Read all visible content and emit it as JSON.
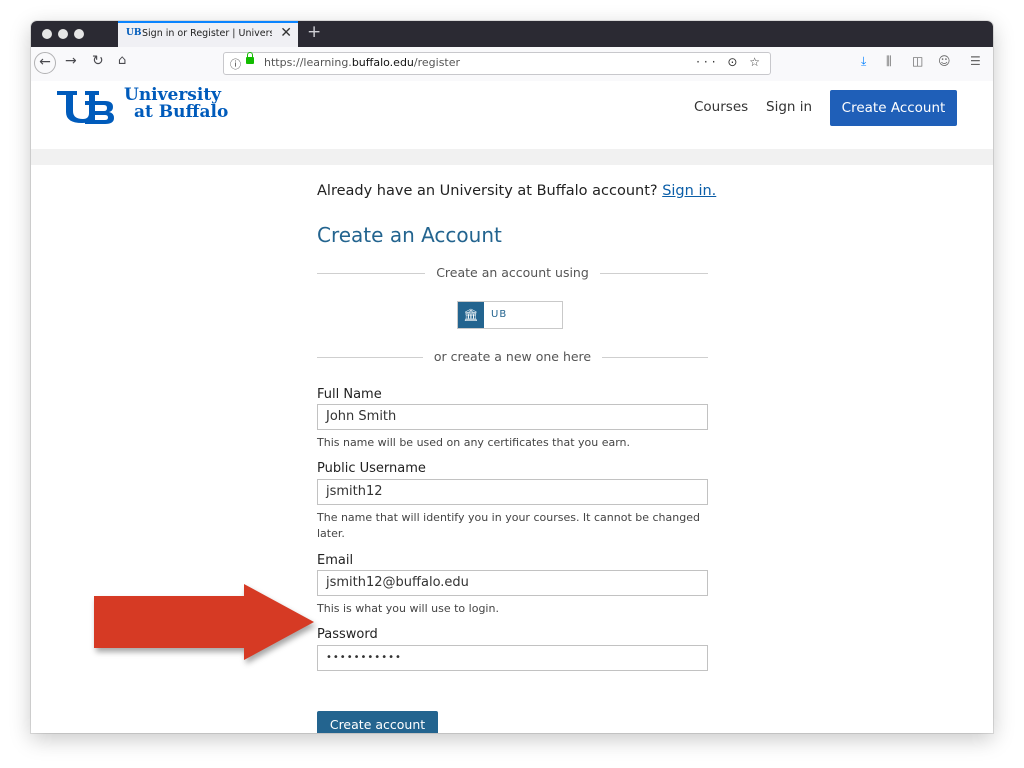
{
  "browser": {
    "tab_title": "Sign in or Register | University at Buffalo",
    "tab_favicon": "UB",
    "url_scheme": "https://learning.",
    "url_domain": "buffalo.edu",
    "url_path": "/register",
    "url_actions": "··· ⊙ ☆"
  },
  "site": {
    "logo_line1": "University",
    "logo_line2": "at Buffalo",
    "nav": {
      "courses": "Courses",
      "signin": "Sign in",
      "create_account": "Create Account"
    },
    "brand_color": "#005bbb"
  },
  "form": {
    "already_text": "Already have an University at Buffalo account?",
    "already_link": "Sign in.",
    "heading": "Create an Account",
    "divider_1": "Create an account using",
    "provider_label": "UB",
    "divider_2": "or create a new one here",
    "fields": {
      "full_name": {
        "label": "Full Name",
        "value": "John Smith",
        "help": "This name will be used on any certificates that you earn."
      },
      "username": {
        "label": "Public Username",
        "value": "jsmith12",
        "help": "The name that will identify you in your courses. It cannot be changed later."
      },
      "email": {
        "label": "Email",
        "value": "jsmith12@buffalo.edu",
        "help": "This is what you will use to login."
      },
      "password": {
        "label": "Password",
        "value": "•••••••••••"
      }
    },
    "submit_label": "Create account",
    "accent_color": "#23648f"
  },
  "annotation": {
    "arrow_color": "#d63a24",
    "arrow_icon": "right-arrow-annotation"
  }
}
